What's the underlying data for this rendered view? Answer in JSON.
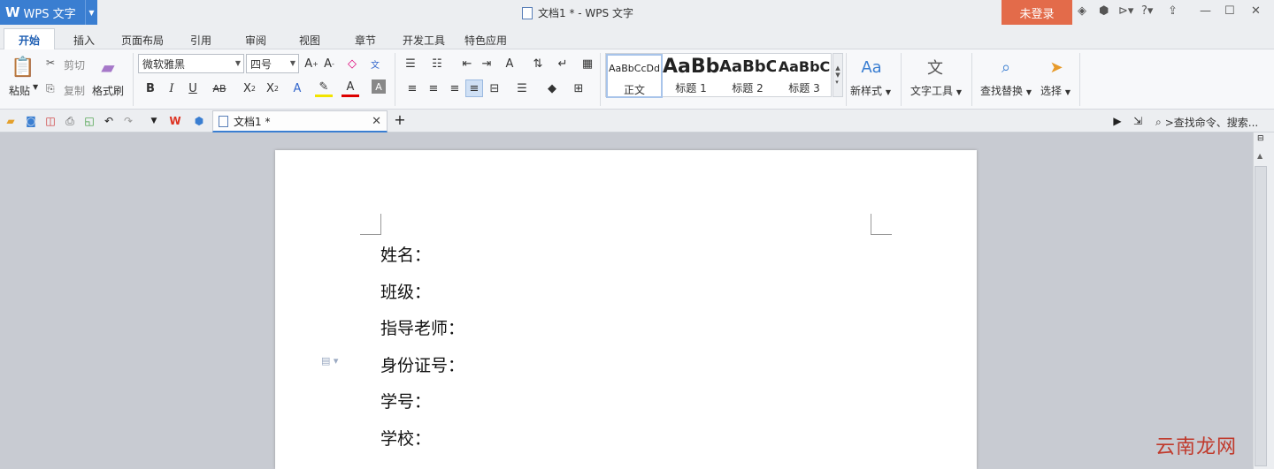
{
  "app": {
    "name": "WPS 文字",
    "window_title": "文档1 * - WPS 文字",
    "login": "未登录"
  },
  "ribbon_tabs": [
    "开始",
    "插入",
    "页面布局",
    "引用",
    "审阅",
    "视图",
    "章节",
    "开发工具",
    "特色应用"
  ],
  "clipboard": {
    "paste": "粘贴",
    "cut": "剪切",
    "copy": "复制",
    "format_painter": "格式刷"
  },
  "font": {
    "name": "微软雅黑",
    "size": "四号"
  },
  "styles": [
    {
      "preview": "AaBbCcDd",
      "label": "正文"
    },
    {
      "preview": "AaBb",
      "label": "标题 1"
    },
    {
      "preview": "AaBbC",
      "label": "标题 2"
    },
    {
      "preview": "AaBbC",
      "label": "标题 3"
    }
  ],
  "tools": {
    "new_style": "新样式",
    "text_tools": "文字工具",
    "find_replace": "查找替换",
    "select": "选择"
  },
  "document_tab": {
    "title": "文档1 *"
  },
  "search": {
    "placeholder": ">查找命令、搜索..."
  },
  "document": {
    "lines": [
      "姓名：",
      "班级：",
      "指导老师：",
      "身份证号：",
      "学号：",
      "学校："
    ]
  },
  "watermark": "云南龙网"
}
